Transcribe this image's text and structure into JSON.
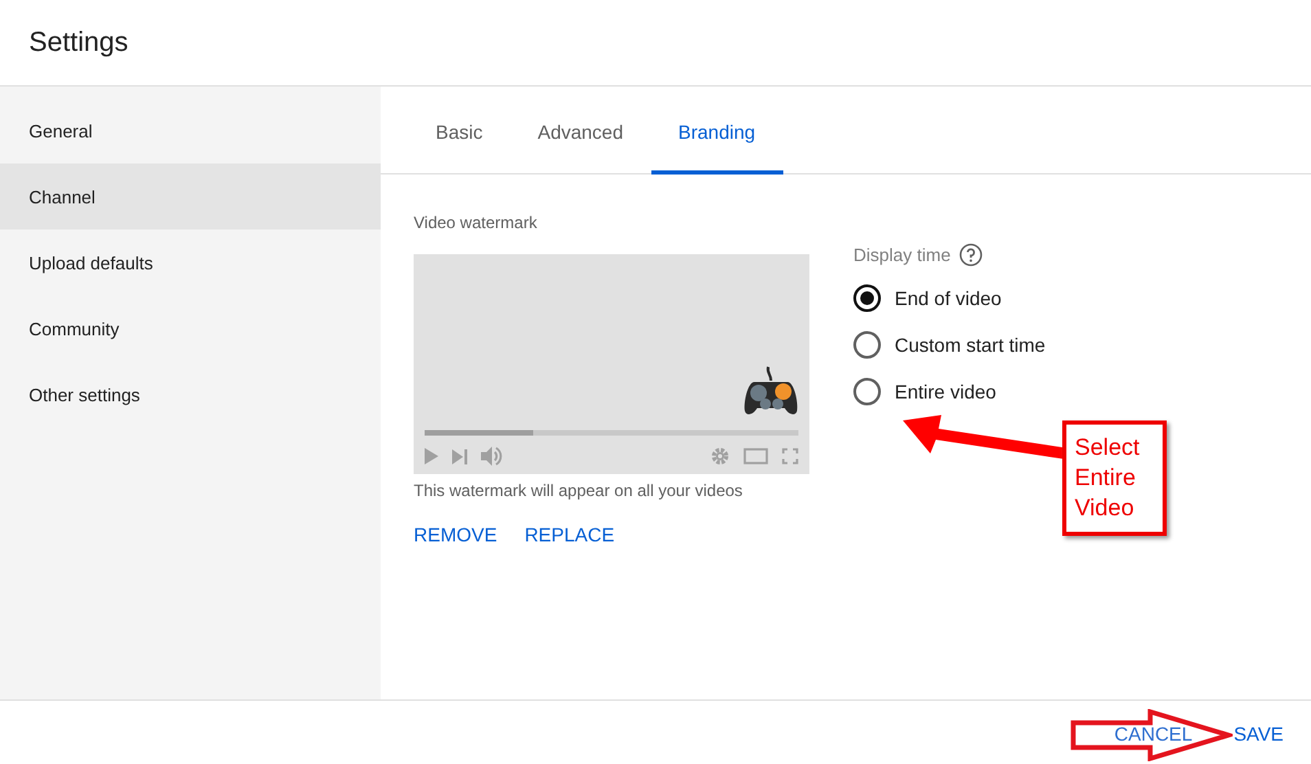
{
  "window": {
    "title": "Settings"
  },
  "sidebar": {
    "items": [
      {
        "label": "General",
        "selected": false
      },
      {
        "label": "Channel",
        "selected": true
      },
      {
        "label": "Upload defaults",
        "selected": false
      },
      {
        "label": "Community",
        "selected": false
      },
      {
        "label": "Other settings",
        "selected": false
      }
    ]
  },
  "tabs": [
    {
      "label": "Basic",
      "selected": false
    },
    {
      "label": "Advanced",
      "selected": false
    },
    {
      "label": "Branding",
      "selected": true
    }
  ],
  "watermark": {
    "label": "Video watermark",
    "caption": "This watermark will appear on all your videos",
    "progress": {
      "level": 0.29
    },
    "actions": [
      "REMOVE",
      "REPLACE"
    ]
  },
  "display_time": {
    "label": "Display time",
    "options": [
      {
        "label": "End of video",
        "selected": true
      },
      {
        "label": "Custom start time",
        "selected": false
      },
      {
        "label": "Entire video",
        "selected": false
      }
    ]
  },
  "annotation": {
    "text": "Select Entire Video"
  },
  "footer": {
    "buttons": [
      {
        "label": "CANCEL",
        "kind": "secondary"
      },
      {
        "label": "SAVE",
        "kind": "primary"
      }
    ]
  }
}
